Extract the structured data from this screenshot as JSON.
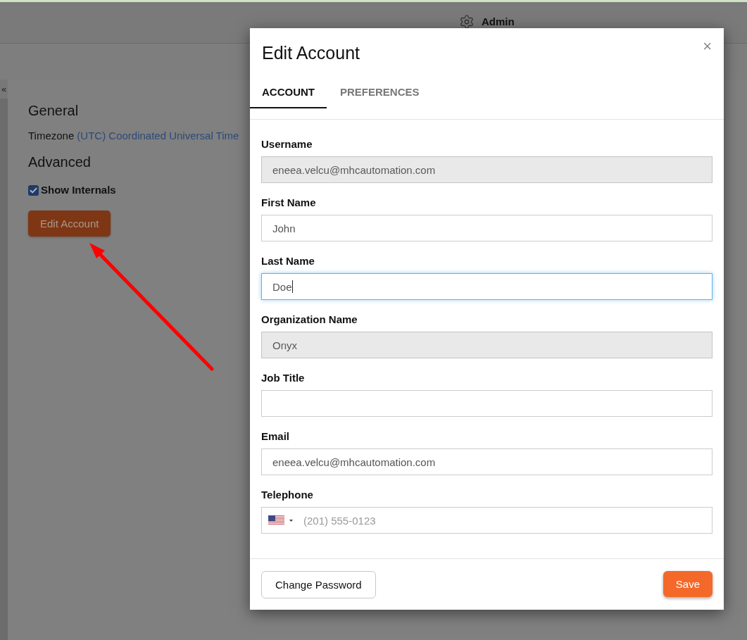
{
  "top_bar": {
    "user_label": "Admin"
  },
  "collapse_button": {
    "label": "«"
  },
  "settings": {
    "general_heading": "General",
    "timezone": {
      "label": "Timezone",
      "value": "(UTC) Coordinated Universal Time"
    },
    "advanced_heading": "Advanced",
    "show_internals": {
      "label": "Show Internals",
      "checked": true
    },
    "edit_button": "Edit Account"
  },
  "dialog": {
    "title": "Edit Account",
    "close_label": "×",
    "tabs": [
      {
        "label": "ACCOUNT",
        "selected": true
      },
      {
        "label": "PREFERENCES",
        "selected": false
      }
    ],
    "fields": [
      {
        "kind": "text",
        "label": "Username",
        "value": "eneea.velcu@mhcautomation.com",
        "disabled": true,
        "focused": false
      },
      {
        "kind": "text",
        "label": "First Name",
        "value": "John",
        "disabled": false,
        "focused": false
      },
      {
        "kind": "text",
        "label": "Last Name",
        "value": "Doe",
        "disabled": false,
        "focused": true
      },
      {
        "kind": "text",
        "label": "Organization Name",
        "value": "Onyx",
        "disabled": true,
        "focused": false
      },
      {
        "kind": "text",
        "label": "Job Title",
        "disabled": false,
        "focused": false
      },
      {
        "kind": "text",
        "label": "Email",
        "value": "eneea.velcu@mhcautomation.com",
        "disabled": false,
        "focused": false
      },
      {
        "kind": "phone",
        "label": "Telephone",
        "placeholder": "(201) 555-0123",
        "disabled": false,
        "focused": false
      }
    ],
    "buttons": [
      {
        "kind": "secondary",
        "label": "Change Password"
      },
      {
        "kind": "primary",
        "label": "Save"
      }
    ]
  }
}
